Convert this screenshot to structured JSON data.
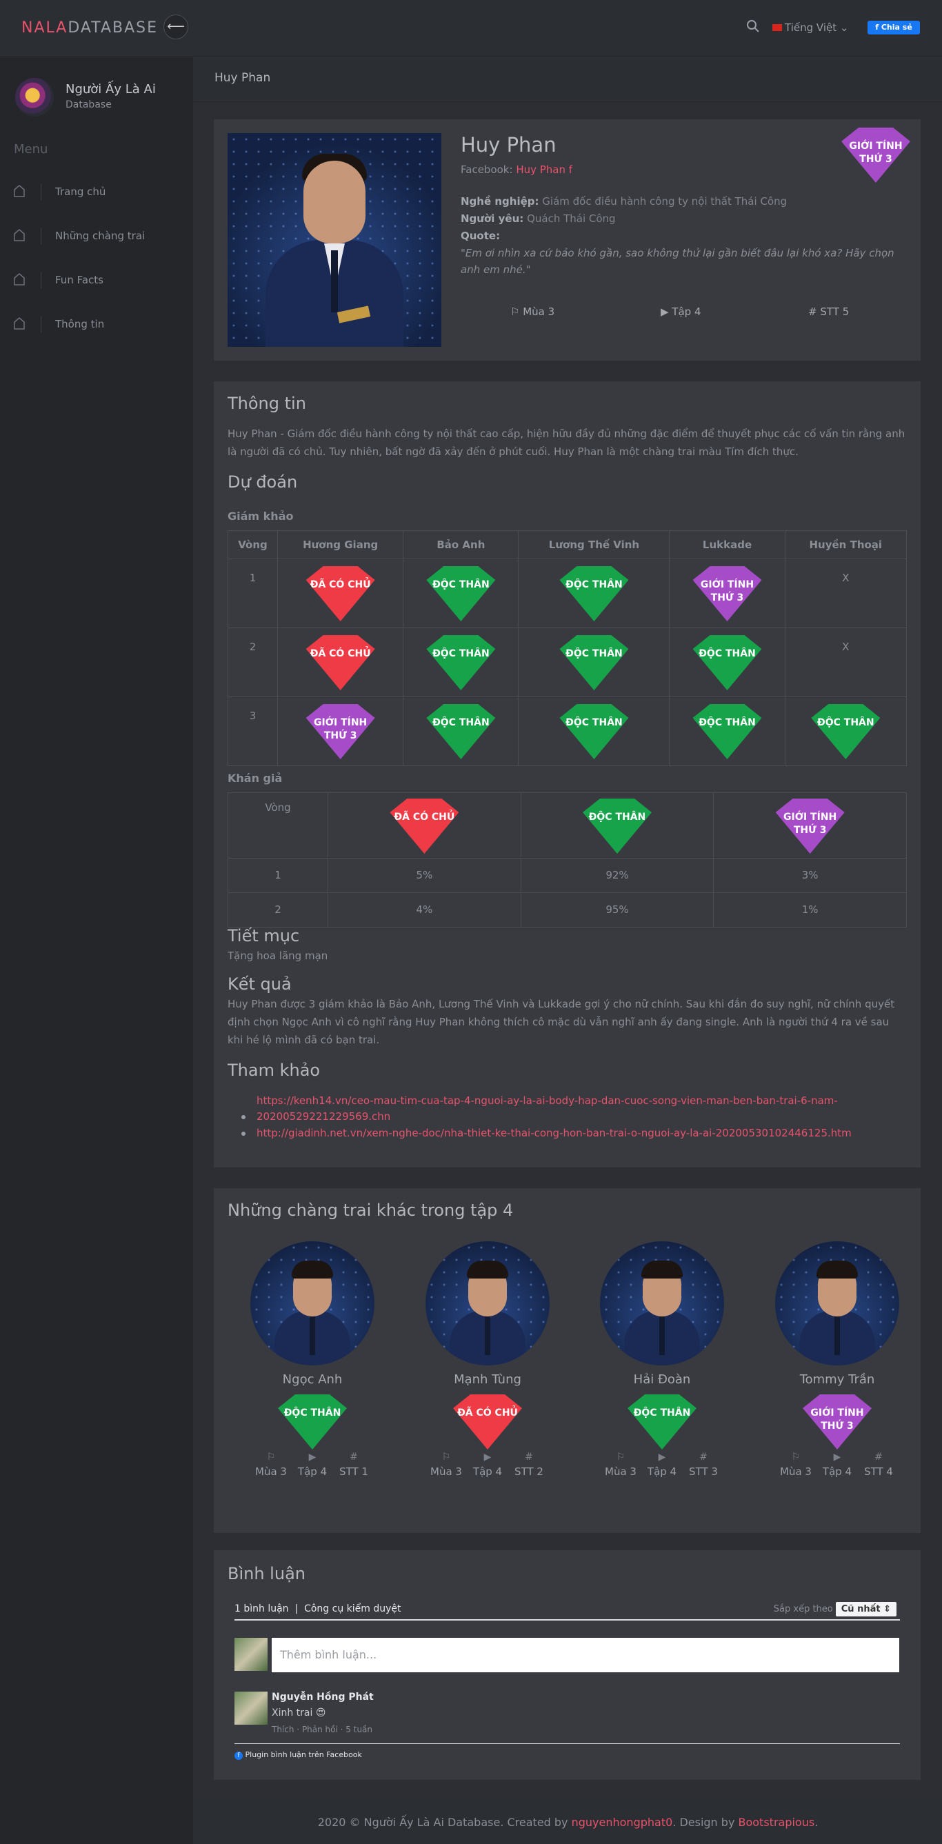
{
  "topbar": {
    "logo_a": "NALA",
    "logo_b": "DATABASE",
    "back_symbol": "⟵",
    "lang_label": "Tiếng Việt",
    "share_label": "Chia sẻ"
  },
  "sidebar": {
    "brand_title": "Người Ấy Là Ai",
    "brand_subtitle": "Database",
    "menu_heading": "Menu",
    "items": [
      {
        "label": "Trang chủ"
      },
      {
        "label": "Những chàng trai"
      },
      {
        "label": "Fun Facts"
      },
      {
        "label": "Thông tin"
      }
    ]
  },
  "breadcrumb": "Huy Phan",
  "profile": {
    "name": "Huy Phan",
    "facebook_label": "Facebook:",
    "facebook_link": "Huy Phan",
    "job_label": "Nghề nghiệp:",
    "job": "Giám đốc điều hành công ty nội thất Thái Công",
    "lover_label": "Người yêu:",
    "lover": "Quách Thái Công",
    "quote_label": "Quote:",
    "quote": "\"Em ơi nhìn xa cứ bảo khó gần, sao không thử lại gần biết đâu lại khó xa? Hãy chọn anh em nhé.\"",
    "gender_badge": "GIỚI TÍNH THỨ 3",
    "season": "Mùa 3",
    "episode": "Tập 4",
    "order": "STT 5"
  },
  "info": {
    "heading": "Thông tin",
    "text": "Huy Phan - Giám đốc điều hành công ty nội thất cao cấp, hiện hữu đầy đủ những đặc điểm để thuyết phục các cố vấn tin rằng anh là người đã có chủ. Tuy nhiên, bất ngờ đã xảy đến ở phút cuối. Huy Phan là một chàng trai màu Tím đích thực.",
    "prediction_heading": "Dự đoán",
    "judges_heading": "Giám khảo",
    "judges_cols": [
      "Vòng",
      "Hương Giang",
      "Bảo Anh",
      "Lương Thế Vinh",
      "Lukkade",
      "Huyền Thoại"
    ],
    "judges_rows": [
      {
        "round": "1",
        "cells": [
          {
            "t": "ĐÃ CÓ CHỦ",
            "c": "red"
          },
          {
            "t": "ĐỘC THÂN",
            "c": "green"
          },
          {
            "t": "ĐỘC THÂN",
            "c": "green"
          },
          {
            "t": "GIỚI TÍNH THỨ 3",
            "c": "purple"
          },
          {
            "t": "X",
            "c": ""
          }
        ]
      },
      {
        "round": "2",
        "cells": [
          {
            "t": "ĐÃ CÓ CHỦ",
            "c": "red"
          },
          {
            "t": "ĐỘC THÂN",
            "c": "green"
          },
          {
            "t": "ĐỘC THÂN",
            "c": "green"
          },
          {
            "t": "ĐỘC THÂN",
            "c": "green"
          },
          {
            "t": "X",
            "c": ""
          }
        ]
      },
      {
        "round": "3",
        "cells": [
          {
            "t": "GIỚI TÍNH THỨ 3",
            "c": "purple"
          },
          {
            "t": "ĐỘC THÂN",
            "c": "green"
          },
          {
            "t": "ĐỘC THÂN",
            "c": "green"
          },
          {
            "t": "ĐỘC THÂN",
            "c": "green"
          },
          {
            "t": "ĐỘC THÂN",
            "c": "green"
          }
        ]
      }
    ],
    "audience_heading": "Khán giả",
    "audience_round_label": "Vòng",
    "audience_cols": [
      {
        "t": "ĐÃ CÓ CHỦ",
        "c": "red"
      },
      {
        "t": "ĐỘC THÂN",
        "c": "green"
      },
      {
        "t": "GIỚI TÍNH THỨ 3",
        "c": "purple"
      }
    ],
    "audience_rows": [
      {
        "round": "1",
        "vals": [
          "5%",
          "92%",
          "3%"
        ]
      },
      {
        "round": "2",
        "vals": [
          "4%",
          "95%",
          "1%"
        ]
      }
    ],
    "act_heading": "Tiết mục",
    "act_text": "Tặng hoa lãng mạn",
    "result_heading": "Kết quả",
    "result_text": "Huy Phan được 3 giám khảo là Bảo Anh, Lương Thế Vinh và Lukkade gợi ý cho nữ chính. Sau khi đắn đo suy nghĩ, nữ chính quyết định chọn Ngọc Anh vì cô nghĩ rằng Huy Phan không thích cô mặc dù vẫn nghĩ anh ấy đang single. Anh là người thứ 4 ra về sau khi hé lộ mình đã có bạn trai.",
    "refs_heading": "Tham khảo",
    "ref1_a": "https://kenh14.vn/ceo-mau-tim-cua-tap-4-nguoi-ay-la-ai-body-hap-dan-cuoc-song-vien-man-ben-ban-trai-6-nam-",
    "ref1_b": "20200529221229569.chn",
    "ref2": "http://giadinh.net.vn/xem-nghe-doc/nha-thiet-ke-thai-cong-hon-ban-trai-o-nguoi-ay-la-ai-20200530102446125.htm"
  },
  "others": {
    "heading": "Những chàng trai khác trong tập 4",
    "boys": [
      {
        "name": "Ngọc Anh",
        "badge": "ĐỘC THÂN",
        "color": "green",
        "season": "Mùa 3",
        "episode": "Tập 4",
        "order": "STT 1"
      },
      {
        "name": "Mạnh Tùng",
        "badge": "ĐÃ CÓ CHỦ",
        "color": "red",
        "season": "Mùa 3",
        "episode": "Tập 4",
        "order": "STT 2"
      },
      {
        "name": "Hải Đoàn",
        "badge": "ĐỘC THÂN",
        "color": "green",
        "season": "Mùa 3",
        "episode": "Tập 4",
        "order": "STT 3"
      },
      {
        "name": "Tommy Trần",
        "badge": "GIỚI TÍNH THỨ 3",
        "color": "purple",
        "season": "Mùa 3",
        "episode": "Tập 4",
        "order": "STT 4"
      }
    ]
  },
  "comments": {
    "heading": "Bình luận",
    "count": "1 bình luận",
    "moderation": "Công cụ kiểm duyệt",
    "sort_label": "Sắp xếp theo",
    "sort_value": "Cũ nhất",
    "input_placeholder": "Thêm bình luận...",
    "author": "Nguyễn Hồng Phát",
    "text": "Xinh trai 😍",
    "like": "Thích",
    "reply": "Phản hồi",
    "time": "5 tuần",
    "plugin": "Plugin bình luận trên Facebook"
  },
  "footer": {
    "text_a": "2020 © Người Ấy Là Ai Database. Created by ",
    "author": "nguyenhongphat0",
    "text_b": ". Design by ",
    "designer": "Bootstrapious",
    "text_c": "."
  }
}
